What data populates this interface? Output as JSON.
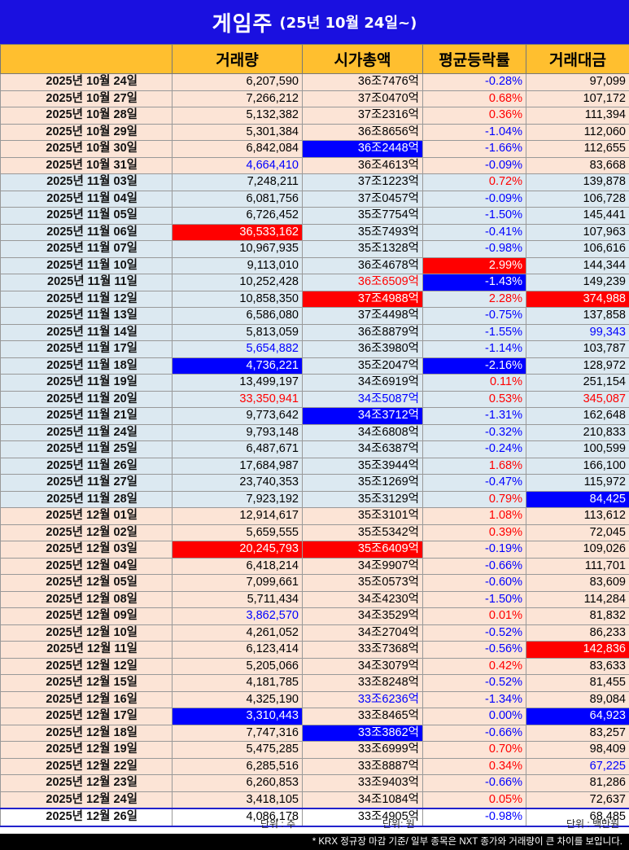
{
  "title": {
    "main": "게임주",
    "sub": "(25년 10월 24일~)"
  },
  "columns": [
    "",
    "거래량",
    "시가총액",
    "평균등락률",
    "거래대금"
  ],
  "rows": [
    {
      "date": "2025년 10월 24일",
      "volume": "6,207,590",
      "cap": "36조7476억",
      "rate": "-0.28%",
      "amount": "97,099",
      "bg": "peach",
      "rate_dir": "neg"
    },
    {
      "date": "2025년 10월 27일",
      "volume": "7,266,212",
      "cap": "37조0470억",
      "rate": "0.68%",
      "amount": "107,172",
      "bg": "peach",
      "rate_dir": "pos"
    },
    {
      "date": "2025년 10월 28일",
      "volume": "5,132,382",
      "cap": "37조2316억",
      "rate": "0.36%",
      "amount": "111,394",
      "bg": "peach",
      "rate_dir": "pos"
    },
    {
      "date": "2025년 10월 29일",
      "volume": "5,301,384",
      "cap": "36조8656억",
      "rate": "-1.04%",
      "amount": "112,060",
      "bg": "peach",
      "rate_dir": "neg"
    },
    {
      "date": "2025년 10월 30일",
      "volume": "6,842,084",
      "cap": "36조2448억",
      "rate": "-1.66%",
      "amount": "112,655",
      "bg": "peach",
      "rate_dir": "neg",
      "cap_style": "hl-blue"
    },
    {
      "date": "2025년 10월 31일",
      "volume": "4,664,410",
      "cap": "36조4613억",
      "rate": "-0.09%",
      "amount": "83,668",
      "bg": "peach",
      "rate_dir": "neg",
      "volume_style": "t-blue"
    },
    {
      "date": "2025년 11월 03일",
      "volume": "7,248,211",
      "cap": "37조1223억",
      "rate": "0.72%",
      "amount": "139,878",
      "bg": "blue",
      "rate_dir": "pos"
    },
    {
      "date": "2025년 11월 04일",
      "volume": "6,081,756",
      "cap": "37조0457억",
      "rate": "-0.09%",
      "amount": "106,728",
      "bg": "blue",
      "rate_dir": "neg"
    },
    {
      "date": "2025년 11월 05일",
      "volume": "6,726,452",
      "cap": "35조7754억",
      "rate": "-1.50%",
      "amount": "145,441",
      "bg": "blue",
      "rate_dir": "neg"
    },
    {
      "date": "2025년 11월 06일",
      "volume": "36,533,162",
      "cap": "35조7493억",
      "rate": "-0.41%",
      "amount": "107,963",
      "bg": "blue",
      "rate_dir": "neg",
      "volume_style": "hl-red"
    },
    {
      "date": "2025년 11월 07일",
      "volume": "10,967,935",
      "cap": "35조1328억",
      "rate": "-0.98%",
      "amount": "106,616",
      "bg": "blue",
      "rate_dir": "neg"
    },
    {
      "date": "2025년 11월 10일",
      "volume": "9,113,010",
      "cap": "36조4678억",
      "rate": "2.99%",
      "amount": "144,344",
      "bg": "blue",
      "rate_dir": "pos",
      "rate_style": "hl-red"
    },
    {
      "date": "2025년 11월 11일",
      "volume": "10,252,428",
      "cap": "36조6509억",
      "rate": "-1.43%",
      "amount": "149,239",
      "bg": "blue",
      "rate_dir": "neg",
      "cap_style": "t-red",
      "rate_style": "hl-blue"
    },
    {
      "date": "2025년 11월 12일",
      "volume": "10,858,350",
      "cap": "37조4988억",
      "rate": "2.28%",
      "amount": "374,988",
      "bg": "blue",
      "rate_dir": "pos",
      "cap_style": "hl-red",
      "amount_style": "hl-red"
    },
    {
      "date": "2025년 11월 13일",
      "volume": "6,586,080",
      "cap": "37조4498억",
      "rate": "-0.75%",
      "amount": "137,858",
      "bg": "blue",
      "rate_dir": "neg"
    },
    {
      "date": "2025년 11월 14일",
      "volume": "5,813,059",
      "cap": "36조8879억",
      "rate": "-1.55%",
      "amount": "99,343",
      "bg": "blue",
      "rate_dir": "neg",
      "amount_style": "t-blue"
    },
    {
      "date": "2025년 11월 17일",
      "volume": "5,654,882",
      "cap": "36조3980억",
      "rate": "-1.14%",
      "amount": "103,787",
      "bg": "blue",
      "rate_dir": "neg",
      "volume_style": "t-blue"
    },
    {
      "date": "2025년 11월 18일",
      "volume": "4,736,221",
      "cap": "35조2047억",
      "rate": "-2.16%",
      "amount": "128,972",
      "bg": "blue",
      "rate_dir": "neg",
      "volume_style": "hl-blue",
      "rate_style": "hl-blue"
    },
    {
      "date": "2025년 11월 19일",
      "volume": "13,499,197",
      "cap": "34조6919억",
      "rate": "0.11%",
      "amount": "251,154",
      "bg": "blue",
      "rate_dir": "pos"
    },
    {
      "date": "2025년 11월 20일",
      "volume": "33,350,941",
      "cap": "34조5087억",
      "rate": "0.53%",
      "amount": "345,087",
      "bg": "blue",
      "rate_dir": "pos",
      "volume_style": "t-red",
      "cap_style": "t-blue",
      "amount_style": "t-red"
    },
    {
      "date": "2025년 11월 21일",
      "volume": "9,773,642",
      "cap": "34조3712억",
      "rate": "-1.31%",
      "amount": "162,648",
      "bg": "blue",
      "rate_dir": "neg",
      "cap_style": "hl-blue"
    },
    {
      "date": "2025년 11월 24일",
      "volume": "9,793,148",
      "cap": "34조6808억",
      "rate": "-0.32%",
      "amount": "210,833",
      "bg": "blue",
      "rate_dir": "neg"
    },
    {
      "date": "2025년 11월 25일",
      "volume": "6,487,671",
      "cap": "34조6387억",
      "rate": "-0.24%",
      "amount": "100,599",
      "bg": "blue",
      "rate_dir": "neg"
    },
    {
      "date": "2025년 11월 26일",
      "volume": "17,684,987",
      "cap": "35조3944억",
      "rate": "1.68%",
      "amount": "166,100",
      "bg": "blue",
      "rate_dir": "pos"
    },
    {
      "date": "2025년 11월 27일",
      "volume": "23,740,353",
      "cap": "35조1269억",
      "rate": "-0.47%",
      "amount": "115,972",
      "bg": "blue",
      "rate_dir": "neg"
    },
    {
      "date": "2025년 11월 28일",
      "volume": "7,923,192",
      "cap": "35조3129억",
      "rate": "0.79%",
      "amount": "84,425",
      "bg": "blue",
      "rate_dir": "pos",
      "amount_style": "hl-blue"
    },
    {
      "date": "2025년 12월 01일",
      "volume": "12,914,617",
      "cap": "35조3101억",
      "rate": "1.08%",
      "amount": "113,612",
      "bg": "peach",
      "rate_dir": "pos"
    },
    {
      "date": "2025년 12월 02일",
      "volume": "5,659,555",
      "cap": "35조5342억",
      "rate": "0.39%",
      "amount": "72,045",
      "bg": "peach",
      "rate_dir": "pos"
    },
    {
      "date": "2025년 12월 03일",
      "volume": "20,245,793",
      "cap": "35조6409억",
      "rate": "-0.19%",
      "amount": "109,026",
      "bg": "peach",
      "rate_dir": "neg",
      "volume_style": "hl-red",
      "cap_style": "hl-red"
    },
    {
      "date": "2025년 12월 04일",
      "volume": "6,418,214",
      "cap": "34조9907억",
      "rate": "-0.66%",
      "amount": "111,701",
      "bg": "peach",
      "rate_dir": "neg"
    },
    {
      "date": "2025년 12월 05일",
      "volume": "7,099,661",
      "cap": "35조0573억",
      "rate": "-0.60%",
      "amount": "83,609",
      "bg": "peach",
      "rate_dir": "neg"
    },
    {
      "date": "2025년 12월 08일",
      "volume": "5,711,434",
      "cap": "34조4230억",
      "rate": "-1.50%",
      "amount": "114,284",
      "bg": "peach",
      "rate_dir": "neg"
    },
    {
      "date": "2025년 12월 09일",
      "volume": "3,862,570",
      "cap": "34조3529억",
      "rate": "0.01%",
      "amount": "81,832",
      "bg": "peach",
      "rate_dir": "pos",
      "volume_style": "t-blue"
    },
    {
      "date": "2025년 12월 10일",
      "volume": "4,261,052",
      "cap": "34조2704억",
      "rate": "-0.52%",
      "amount": "86,233",
      "bg": "peach",
      "rate_dir": "neg"
    },
    {
      "date": "2025년 12월 11일",
      "volume": "6,123,414",
      "cap": "33조7368억",
      "rate": "-0.56%",
      "amount": "142,836",
      "bg": "peach",
      "rate_dir": "neg",
      "amount_style": "hl-red"
    },
    {
      "date": "2025년 12월 12일",
      "volume": "5,205,066",
      "cap": "34조3079억",
      "rate": "0.42%",
      "amount": "83,633",
      "bg": "peach",
      "rate_dir": "pos"
    },
    {
      "date": "2025년 12월 15일",
      "volume": "4,181,785",
      "cap": "33조8248억",
      "rate": "-0.52%",
      "amount": "81,455",
      "bg": "peach",
      "rate_dir": "neg"
    },
    {
      "date": "2025년 12월 16일",
      "volume": "4,325,190",
      "cap": "33조6236억",
      "rate": "-1.34%",
      "amount": "89,084",
      "bg": "peach",
      "rate_dir": "neg",
      "cap_style": "t-blue"
    },
    {
      "date": "2025년 12월 17일",
      "volume": "3,310,443",
      "cap": "33조8465억",
      "rate": "0.00%",
      "amount": "64,923",
      "bg": "peach",
      "rate_dir": "neg",
      "volume_style": "hl-blue",
      "amount_style": "hl-blue"
    },
    {
      "date": "2025년 12월 18일",
      "volume": "7,747,316",
      "cap": "33조3862억",
      "rate": "-0.66%",
      "amount": "83,257",
      "bg": "peach",
      "rate_dir": "neg",
      "cap_style": "hl-blue"
    },
    {
      "date": "2025년 12월 19일",
      "volume": "5,475,285",
      "cap": "33조6999억",
      "rate": "0.70%",
      "amount": "98,409",
      "bg": "peach",
      "rate_dir": "pos"
    },
    {
      "date": "2025년 12월 22일",
      "volume": "6,285,516",
      "cap": "33조8887억",
      "rate": "0.34%",
      "amount": "67,225",
      "bg": "peach",
      "rate_dir": "pos",
      "amount_style": "t-blue"
    },
    {
      "date": "2025년 12월 23일",
      "volume": "6,260,853",
      "cap": "33조9403억",
      "rate": "-0.66%",
      "amount": "81,286",
      "bg": "peach",
      "rate_dir": "neg"
    },
    {
      "date": "2025년 12월 24일",
      "volume": "3,418,105",
      "cap": "34조1084억",
      "rate": "0.05%",
      "amount": "72,637",
      "bg": "peach",
      "rate_dir": "pos"
    },
    {
      "date": "2025년 12월 26일",
      "volume": "4,086,178",
      "cap": "33조4905억",
      "rate": "-0.98%",
      "amount": "68,485",
      "bg": "last",
      "rate_dir": "neg"
    }
  ],
  "units": {
    "volume": "단위 : 주",
    "cap": "단위: 원",
    "amount": "단위 : 백만원"
  },
  "footnote": "* KRX 정규장 마감 기준/ 일부 종목은 NXT 종가와 거래량이 큰 차이를 보입니다.",
  "colors": {
    "title_bg": "#1a10e0",
    "header_bg": "#ffbf2f",
    "peach": "#fce4d6",
    "blue_row": "#dce9f1",
    "up": "#ff0000",
    "down": "#0000ff"
  }
}
